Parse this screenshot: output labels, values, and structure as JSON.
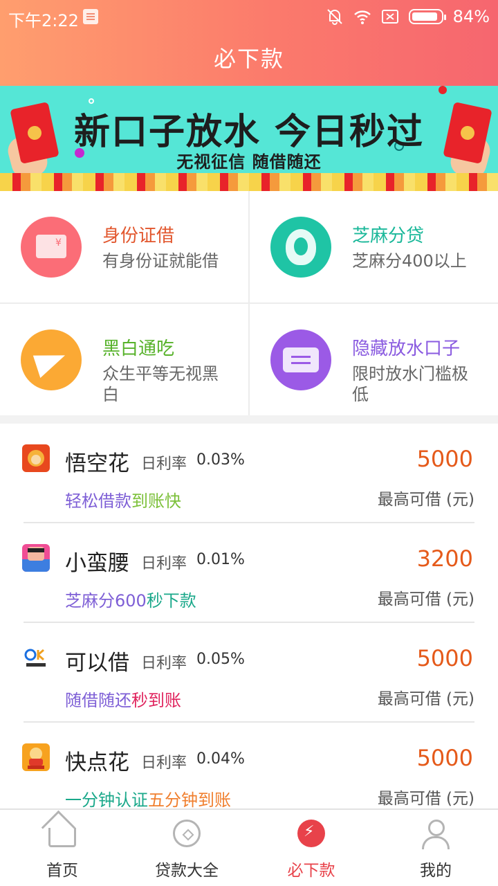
{
  "status_bar": {
    "time": "下午2:22",
    "battery": "84%"
  },
  "header": {
    "title": "必下款"
  },
  "banner": {
    "headline": "新口子放水 今日秒过",
    "subline": "无视征信 随借随还"
  },
  "categories": [
    {
      "title": "身份证借",
      "desc": "有身份证就能借",
      "color": "#e2572e",
      "icon": "id-card-icon"
    },
    {
      "title": "芝麻分贷",
      "desc": "芝麻分400以上",
      "color": "#1bb89a",
      "icon": "sesame-icon"
    },
    {
      "title": "黑白通吃",
      "desc": "众生平等无视黑白",
      "color": "#57b22a",
      "icon": "paper-plane-icon"
    },
    {
      "title": "隐藏放水口子",
      "desc": "限时放水门槛极低",
      "color": "#8a5be0",
      "icon": "ticket-icon"
    }
  ],
  "loans": [
    {
      "name": "悟空花",
      "rate_label": "日利率",
      "rate": "0.03%",
      "amount": "5000",
      "max_label": "最高可借 (元)",
      "tag_a": "轻松借款",
      "tag_a_color": "#7e5fd6",
      "tag_b": "到账快",
      "tag_b_color": "#7cc03a"
    },
    {
      "name": "小蛮腰",
      "rate_label": "日利率",
      "rate": "0.01%",
      "amount": "3200",
      "max_label": "最高可借 (元)",
      "tag_a": "芝麻分600",
      "tag_a_color": "#7e5fd6",
      "tag_b": "秒下款",
      "tag_b_color": "#1aa88a"
    },
    {
      "name": "可以借",
      "rate_label": "日利率",
      "rate": "0.05%",
      "amount": "5000",
      "max_label": "最高可借 (元)",
      "tag_a": "随借随还",
      "tag_a_color": "#7e5fd6",
      "tag_b": "秒到账",
      "tag_b_color": "#e0245e"
    },
    {
      "name": "快点花",
      "rate_label": "日利率",
      "rate": "0.04%",
      "amount": "5000",
      "max_label": "最高可借 (元)",
      "tag_a": "一分钟认证",
      "tag_a_color": "#1aa88a",
      "tag_b": "五分钟到账",
      "tag_b_color": "#f07f2e"
    }
  ],
  "nav": [
    {
      "label": "首页",
      "icon": "home-icon"
    },
    {
      "label": "贷款大全",
      "icon": "coin-icon"
    },
    {
      "label": "必下款",
      "icon": "lightning-icon",
      "active": true
    },
    {
      "label": "我的",
      "icon": "user-icon"
    }
  ]
}
